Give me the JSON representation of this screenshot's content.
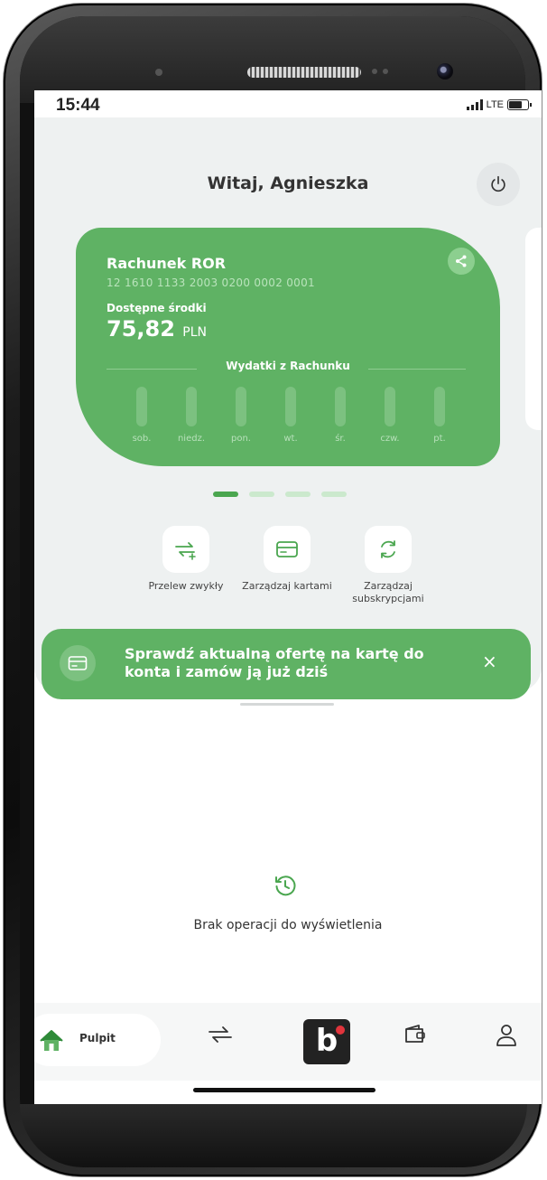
{
  "status_bar": {
    "time": "15:44",
    "network": "LTE"
  },
  "header": {
    "greeting": "Witaj, Agnieszka",
    "power_icon": "power-icon"
  },
  "account_card": {
    "name": "Rachunek ROR",
    "number": "12 1610 1133 2003 0200 0002 0001",
    "available_label": "Dostępne środki",
    "balance": "75,82",
    "currency": "PLN",
    "spending_title": "Wydatki z Rachunku",
    "days": [
      "sob.",
      "niedz.",
      "pon.",
      "wt.",
      "śr.",
      "czw.",
      "pt."
    ],
    "share_icon": "share-icon"
  },
  "carousel": {
    "pages": 4,
    "active_page": 1
  },
  "quick_actions": [
    {
      "label": "Przelew zwykły",
      "icon": "transfer-icon"
    },
    {
      "label": "Zarządzaj kartami",
      "icon": "card-icon"
    },
    {
      "label": "Zarządzaj subskrypcjami",
      "icon": "refresh-icon"
    }
  ],
  "banner": {
    "text": "Sprawdź aktualną ofertę na kartę do konta i zamów ją już dziś",
    "close": "×",
    "icon": "card-icon"
  },
  "history": {
    "empty_text": "Brak operacji do wyświetlenia",
    "icon": "history-icon"
  },
  "bottom_nav": {
    "items": [
      {
        "label": "Pulpit",
        "icon": "home-icon",
        "active": true
      },
      {
        "label": "",
        "icon": "transfer-icon"
      },
      {
        "label": "",
        "icon": "blik-icon"
      },
      {
        "label": "",
        "icon": "wallet-icon"
      },
      {
        "label": "",
        "icon": "profile-icon"
      }
    ],
    "blik_letter": "b"
  },
  "colors": {
    "brand_green": "#5fb264",
    "dark_green": "#4aa64f",
    "panel_bg": "#eef1f1",
    "blik_red": "#e1343c"
  }
}
